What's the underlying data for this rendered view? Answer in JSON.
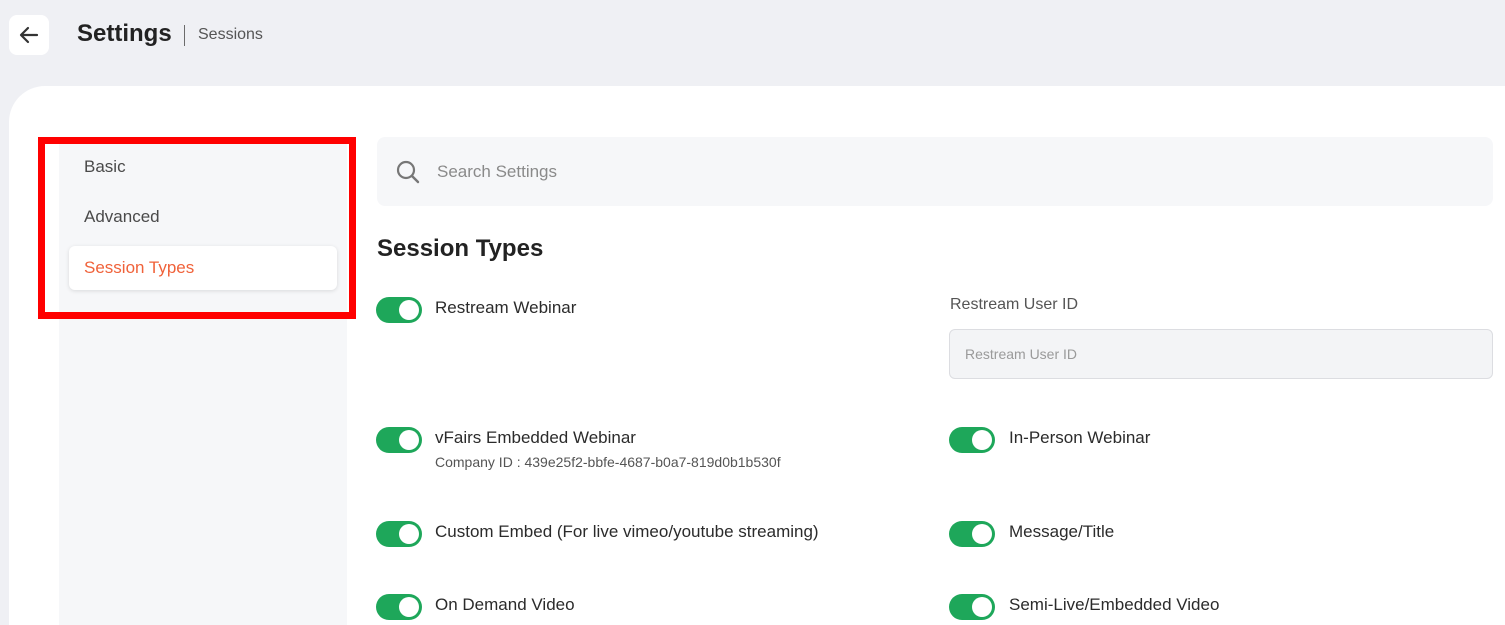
{
  "header": {
    "title": "Settings",
    "breadcrumb": "Sessions",
    "back_icon": "arrow-left-icon"
  },
  "sidebar": {
    "items": [
      {
        "label": "Basic",
        "active": false
      },
      {
        "label": "Advanced",
        "active": false
      },
      {
        "label": "Session Types",
        "active": true
      }
    ],
    "active_color": "#f0623a",
    "highlight_color": "#ff0000"
  },
  "search": {
    "placeholder": "Search Settings",
    "icon": "search-icon"
  },
  "section": {
    "title": "Session Types"
  },
  "options": {
    "restream_webinar": {
      "label": "Restream Webinar",
      "enabled": true
    },
    "restream_user_id": {
      "label": "Restream User ID",
      "placeholder": "Restream User ID",
      "value": ""
    },
    "vfairs_embedded_webinar": {
      "label": "vFairs Embedded Webinar",
      "enabled": true,
      "sub": "Company ID : 439e25f2-bbfe-4687-b0a7-819d0b1b530f"
    },
    "in_person_webinar": {
      "label": "In-Person Webinar",
      "enabled": true
    },
    "custom_embed": {
      "label": "Custom Embed (For live vimeo/youtube streaming)",
      "enabled": true
    },
    "message_title": {
      "label": "Message/Title",
      "enabled": true
    },
    "on_demand_video": {
      "label": "On Demand Video",
      "enabled": true
    },
    "semi_live_embedded_video": {
      "label": "Semi-Live/Embedded Video",
      "enabled": true
    }
  },
  "colors": {
    "toggle_on": "#1ea75a",
    "page_bg": "#eff0f4"
  }
}
